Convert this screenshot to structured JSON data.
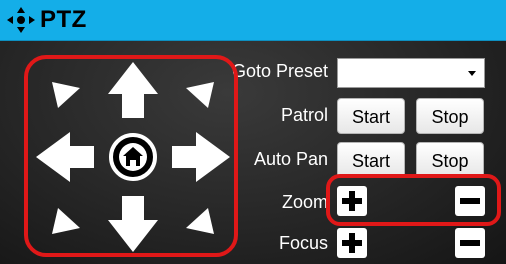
{
  "header": {
    "title": "PTZ",
    "icon": "ptz-move-icon"
  },
  "ptz": {
    "goto_preset_label": "Goto Preset",
    "goto_preset_value": "",
    "patrol_label": "Patrol",
    "auto_pan_label": "Auto Pan",
    "zoom_label": "Zoom",
    "focus_label": "Focus",
    "start_label": "Start",
    "stop_label": "Stop"
  },
  "colors": {
    "header": "#14aee8",
    "highlight": "#e01818",
    "panel": "#262626"
  }
}
